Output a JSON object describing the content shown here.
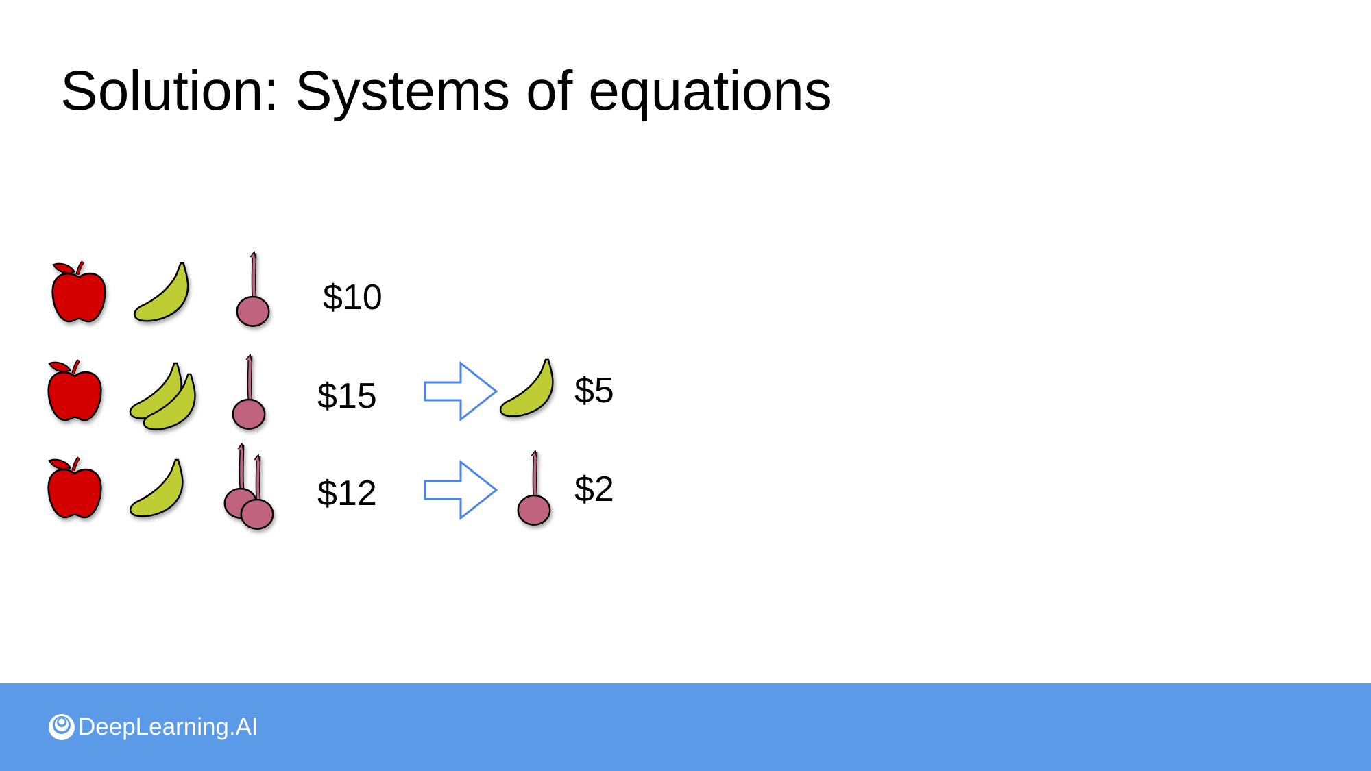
{
  "title": "Solution: Systems of equations",
  "rows": [
    {
      "items": [
        "apple",
        "banana",
        "cherry"
      ],
      "price": "$10"
    },
    {
      "items": [
        "apple",
        "banana",
        "banana",
        "cherry"
      ],
      "price": "$15",
      "result_item": "banana",
      "result_price": "$5"
    },
    {
      "items": [
        "apple",
        "banana",
        "cherry",
        "cherry"
      ],
      "price": "$12",
      "result_item": "cherry",
      "result_price": "$2"
    }
  ],
  "colors": {
    "apple": "#d40000",
    "banana": "#bfcd35",
    "cherry": "#bf6380",
    "arrow": "#4a86e8",
    "footer": "#5b9ae7"
  },
  "footer": {
    "brand": "DeepLearning.AI"
  }
}
